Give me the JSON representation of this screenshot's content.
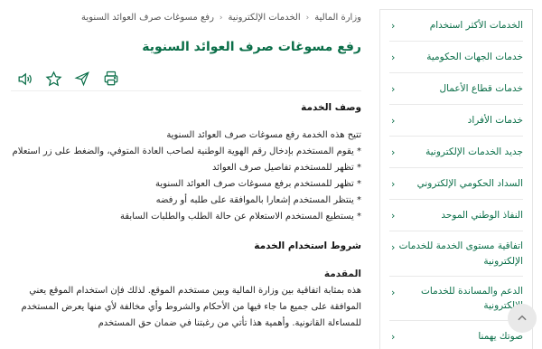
{
  "breadcrumb": {
    "items": [
      "وزارة المالية",
      "الخدمات الإلكترونية",
      "رفع مسوغات صرف العوائد السنوية"
    ]
  },
  "page": {
    "title": "رفع مسوغات صرف العوائد السنوية"
  },
  "sidebar": {
    "items": [
      {
        "label": "الخدمات الأكثر استخدام"
      },
      {
        "label": "خدمات الجهات الحكومية"
      },
      {
        "label": "خدمات قطاع الأعمال"
      },
      {
        "label": "خدمات الأفراد"
      },
      {
        "label": "جديد الخدمات الإلكترونية"
      },
      {
        "label": "السداد الحكومي الإلكتروني"
      },
      {
        "label": "النفاذ الوطني الموحد"
      },
      {
        "label": "اتفاقية مستوى الخدمة للخدمات الإلكترونية"
      },
      {
        "label": "الدعم والمساندة للخدمات الإلكترونية"
      },
      {
        "label": "صوتك يهمنا"
      }
    ]
  },
  "content": {
    "desc_heading": "وصف الخدمة",
    "desc_lines": [
      "تتيح هذه الخدمة رفع مسوغات صرف العوائد السنوية",
      "* يقوم المستخدم بإدخال رقم الهوية الوطنية لصاحب العادة المتوفي، والضغط على زر استعلام",
      "* تظهر للمستخدم تفاصيل صرف العوائد",
      "* تظهر للمستخدم برفع مسوغات صرف العوائد السنوية",
      "* ينتظر المستخدم إشعارا بالموافقة على طلبه أو رفضه",
      "* يستطيع المستخدم الاستعلام عن حالة الطلب والطلبات السابقة"
    ],
    "terms_heading": "شروط استخدام الخدمة",
    "intro_heading": "المقدمة",
    "intro_text": "هذه بمثابة اتفاقية بين وزارة المالية وبين مستخدم الموقع. لذلك فإن استخدام الموقع يعني الموافقة على جميع ما جاء فيها من الأحكام والشروط وأي مخالفة لأي منها يعرض المستخدم للمساءلة القانونية. وأهمية هذا تأتي من رغبتنا في ضمان حق المستخدم"
  },
  "colors": {
    "accent": "#0a6e48"
  }
}
